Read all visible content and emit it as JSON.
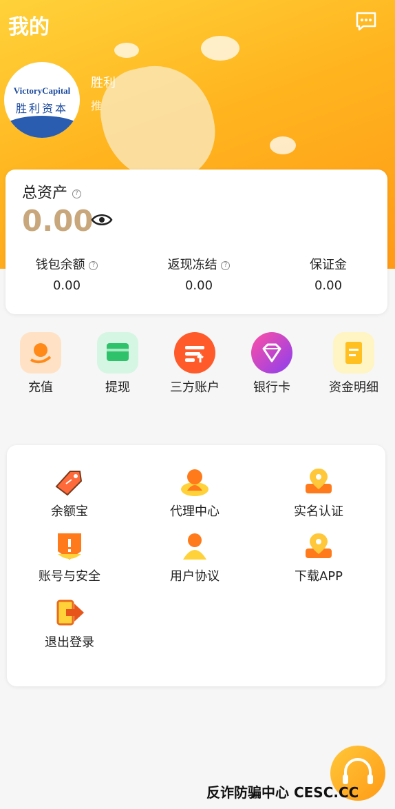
{
  "header": {
    "title": "我的"
  },
  "profile": {
    "brand_en": "VictoryCapital",
    "brand_cn": "胜利资本",
    "name_partial": "胜利",
    "sub_partial": "推"
  },
  "assets": {
    "title": "总资产",
    "total": "0.00",
    "stats": [
      {
        "label": "钱包余额",
        "value": "0.00"
      },
      {
        "label": "返现冻结",
        "value": "0.00"
      },
      {
        "label": "保证金",
        "value": "0.00"
      }
    ]
  },
  "quick_actions": [
    {
      "label": "充值",
      "icon": "recharge-icon"
    },
    {
      "label": "提现",
      "icon": "withdraw-icon"
    },
    {
      "label": "三方账户",
      "icon": "third-party-account-icon"
    },
    {
      "label": "银行卡",
      "icon": "bank-card-icon"
    },
    {
      "label": "资金明细",
      "icon": "fund-details-icon"
    }
  ],
  "menu": [
    {
      "label": "余额宝",
      "icon": "tag-icon"
    },
    {
      "label": "代理中心",
      "icon": "agent-icon"
    },
    {
      "label": "实名认证",
      "icon": "location-pin-icon"
    },
    {
      "label": "账号与安全",
      "icon": "shield-alert-icon"
    },
    {
      "label": "用户协议",
      "icon": "user-icon"
    },
    {
      "label": "下载APP",
      "icon": "location-pin-icon"
    },
    {
      "label": "退出登录",
      "icon": "logout-icon"
    }
  ],
  "watermark": {
    "text": "反诈防骗中心 CESC.CC"
  },
  "colors": {
    "accent": "#ff9a16",
    "total": "#c8a77c"
  }
}
